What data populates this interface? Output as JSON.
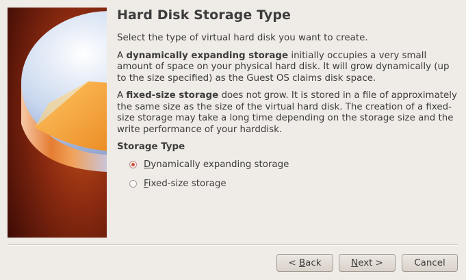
{
  "dialog": {
    "title": "Hard Disk Storage Type",
    "intro": "Select the type of virtual hard disk you want to create.",
    "dynamic_desc": {
      "prefix": "A ",
      "bold": "dynamically expanding storage",
      "suffix": " initially occupies a very small amount of space on your physical hard disk. It will grow dynamically (up to the size specified) as the Guest OS claims disk space."
    },
    "fixed_desc": {
      "prefix": "A ",
      "bold": "fixed-size storage",
      "suffix": " does not grow. It is stored in a file of approximately the same size as the size of the virtual hard disk. The creation of a fixed-size storage may take a long time depending on the storage size and the write performance of your harddisk."
    },
    "storage_type_label": "Storage Type",
    "options": [
      {
        "mnemonic": "D",
        "rest": "ynamically expanding storage",
        "checked": true
      },
      {
        "mnemonic": "F",
        "rest": "ixed-size storage",
        "checked": false
      }
    ]
  },
  "buttons": {
    "back": {
      "prefix": "< ",
      "mnemonic": "B",
      "rest": "ack"
    },
    "next": {
      "prefix": "",
      "mnemonic": "N",
      "rest": "ext >"
    },
    "cancel": {
      "label": "Cancel"
    }
  },
  "art": {
    "icon": "hard-disk-pie-icon"
  }
}
